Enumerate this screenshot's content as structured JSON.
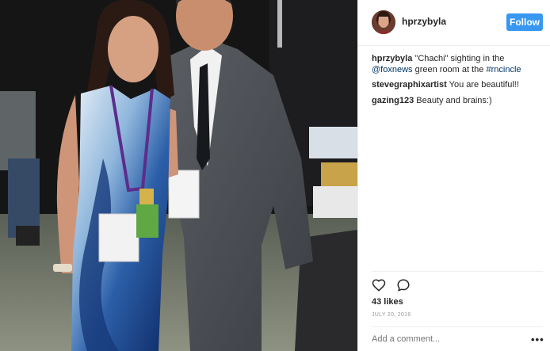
{
  "post": {
    "username": "hprzybyla",
    "follow_label": "Follow",
    "likes": "43 likes",
    "date": "JULY 20, 2016",
    "add_comment_placeholder": "Add a comment...",
    "more_label": "•••"
  },
  "caption": {
    "user": "hprzybyla",
    "text_1": " \"Chachi\" sighting in the ",
    "mention": "@foxnews",
    "text_2": " green room at the ",
    "hashtag": "#rncincle"
  },
  "comments": [
    {
      "user": "stevegraphixartist",
      "text": " You are beautiful!!"
    },
    {
      "user": "gazing123",
      "text": " Beauty and brains:)"
    }
  ],
  "icons": {
    "like": "heart-icon",
    "comment": "speech-bubble-icon",
    "more": "more-options-icon"
  },
  "colors": {
    "follow_bg": "#3897f0",
    "link": "#003569"
  }
}
